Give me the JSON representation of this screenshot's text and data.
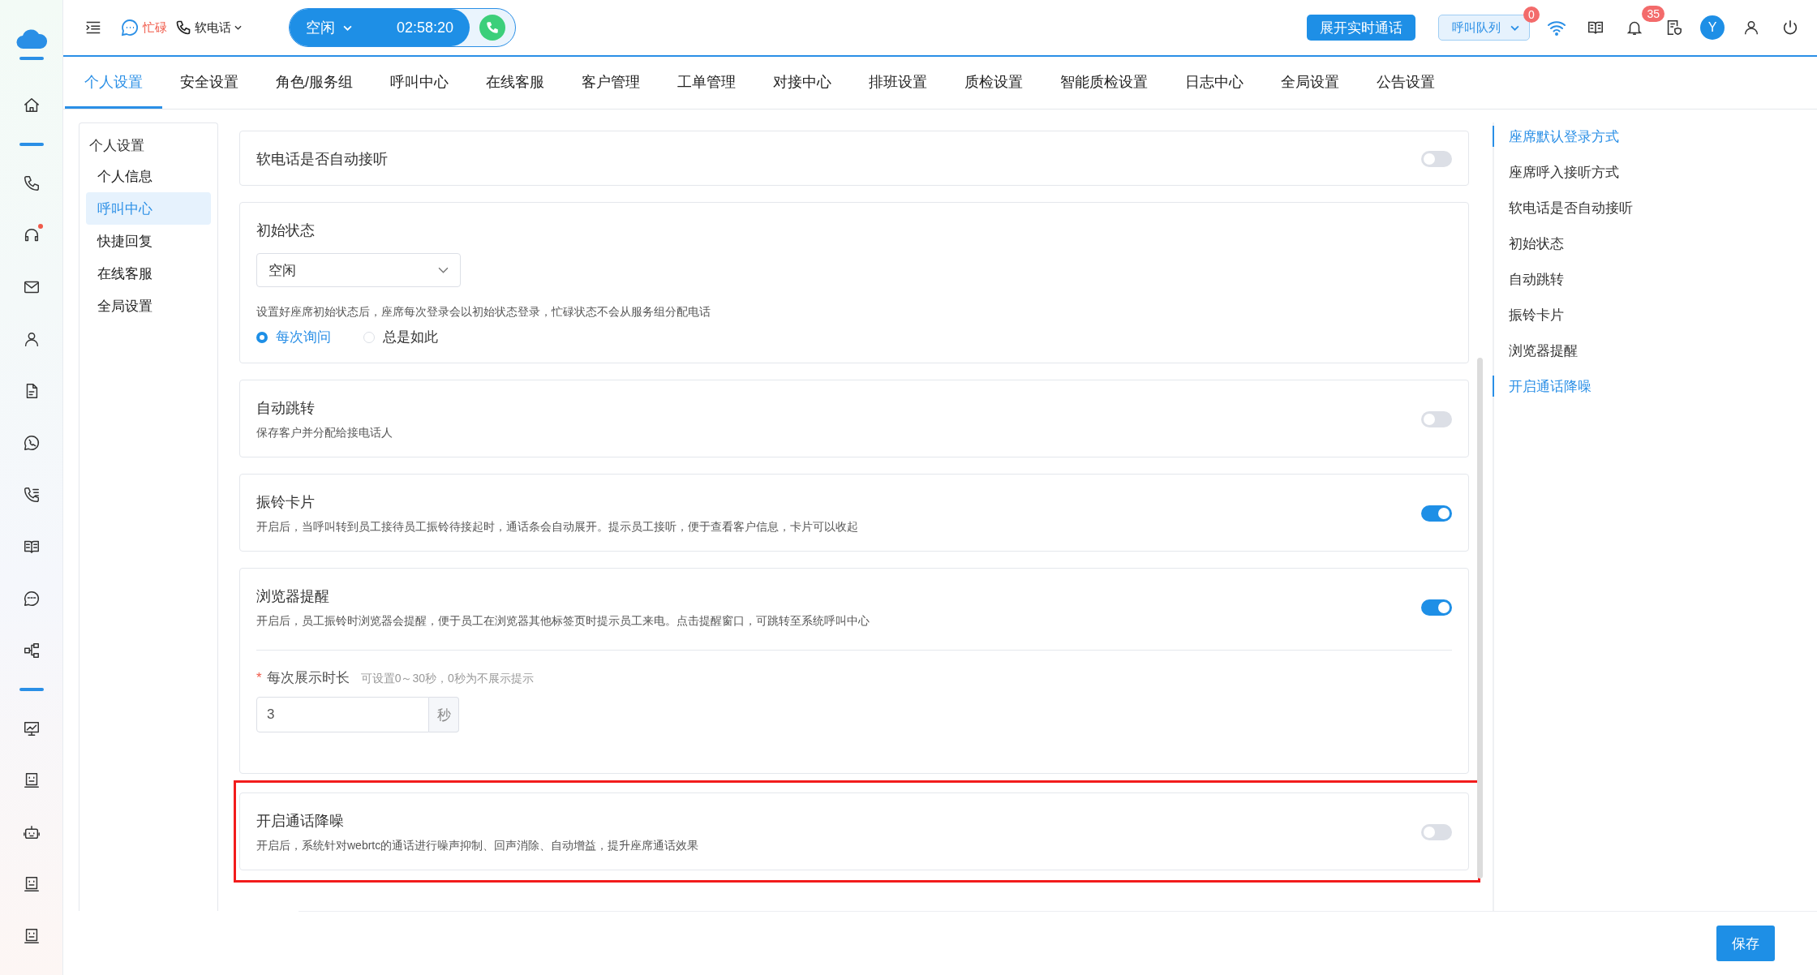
{
  "rail_groups": [
    [
      {
        "kind": "home",
        "dot": false
      }
    ],
    [
      {
        "kind": "phone",
        "dot": false
      },
      {
        "kind": "headset",
        "dot": true
      },
      {
        "kind": "mail",
        "dot": false
      },
      {
        "kind": "user",
        "dot": false
      },
      {
        "kind": "document",
        "dot": false
      },
      {
        "kind": "chat-phone",
        "dot": false
      },
      {
        "kind": "phone-list",
        "dot": false
      },
      {
        "kind": "book",
        "dot": false
      },
      {
        "kind": "sms",
        "dot": false
      },
      {
        "kind": "flow",
        "dot": false
      }
    ],
    [
      {
        "kind": "monitor",
        "dot": false
      },
      {
        "kind": "screen",
        "dot": false
      },
      {
        "kind": "robot",
        "dot": false
      },
      {
        "kind": "screen",
        "dot": false
      },
      {
        "kind": "screen",
        "dot": false
      }
    ]
  ],
  "header": {
    "agent_status": "忙碌",
    "softphone": "软电话",
    "call_status": "空闲",
    "timer": "02:58:20",
    "expand_button": "展开实时通话",
    "queue": "呼叫队列",
    "queue_badge": "0",
    "notify_badge": "35",
    "avatar": "Y"
  },
  "tabs": [
    {
      "label": "个人设置",
      "selected": true
    },
    {
      "label": "安全设置",
      "selected": false
    },
    {
      "label": "角色/服务组",
      "selected": false
    },
    {
      "label": "呼叫中心",
      "selected": false
    },
    {
      "label": "在线客服",
      "selected": false
    },
    {
      "label": "客户管理",
      "selected": false
    },
    {
      "label": "工单管理",
      "selected": false
    },
    {
      "label": "对接中心",
      "selected": false
    },
    {
      "label": "排班设置",
      "selected": false
    },
    {
      "label": "质检设置",
      "selected": false
    },
    {
      "label": "智能质检设置",
      "selected": false
    },
    {
      "label": "日志中心",
      "selected": false
    },
    {
      "label": "全局设置",
      "selected": false
    },
    {
      "label": "公告设置",
      "selected": false
    }
  ],
  "sidebar": {
    "title": "个人设置",
    "items": [
      {
        "label": "个人信息",
        "selected": false
      },
      {
        "label": "呼叫中心",
        "selected": true
      },
      {
        "label": "快捷回复",
        "selected": false
      },
      {
        "label": "在线客服",
        "selected": false
      },
      {
        "label": "全局设置",
        "selected": false
      }
    ]
  },
  "settings": [
    {
      "kind": "toggle",
      "title": "软电话是否自动接听",
      "on": false,
      "highlighted": false
    },
    {
      "kind": "select",
      "title": "初始状态",
      "value": "空闲",
      "description": "设置好座席初始状态后，座席每次登录会以初始状态登录，忙碌状态不会从服务组分配电话",
      "options": [
        {
          "label": "每次询问",
          "selected": true
        },
        {
          "label": "总是如此",
          "selected": false
        }
      ],
      "highlighted": false
    },
    {
      "kind": "toggle",
      "title": "自动跳转",
      "description": "保存客户并分配给接电话人",
      "on": false,
      "highlighted": false
    },
    {
      "kind": "toggle",
      "title": "振铃卡片",
      "description": "开启后，当呼叫转到员工接待员工振铃待接起时，通话条会自动展开。提示员工接听，便于查看客户信息，卡片可以收起",
      "on": true,
      "highlighted": false
    },
    {
      "kind": "toggle",
      "title": "浏览器提醒",
      "description": "开启后，员工振铃时浏览器会提醒，便于员工在浏览器其他标签页时提示员工来电。点击提醒窗口，可跳转至系统呼叫中心",
      "on": true,
      "highlighted": false,
      "subfield": {
        "required_mark": "*",
        "label": "每次展示时长",
        "hint": "可设置0～30秒，0秒为不展示提示",
        "value": "3",
        "unit": "秒"
      }
    },
    {
      "kind": "toggle",
      "title": "开启通话降噪",
      "description": "开启后，系统针对webrtc的通话进行噪声抑制、回声消除、自动增益，提升座席通话效果",
      "on": false,
      "highlighted": true
    }
  ],
  "anchors": [
    {
      "label": "座席默认登录方式",
      "selected": true
    },
    {
      "label": "座席呼入接听方式",
      "selected": false
    },
    {
      "label": "软电话是否自动接听",
      "selected": false
    },
    {
      "label": "初始状态",
      "selected": false
    },
    {
      "label": "自动跳转",
      "selected": false
    },
    {
      "label": "振铃卡片",
      "selected": false
    },
    {
      "label": "浏览器提醒",
      "selected": false
    },
    {
      "label": "开启通话降噪",
      "selected": true
    }
  ],
  "save_button": "保存"
}
